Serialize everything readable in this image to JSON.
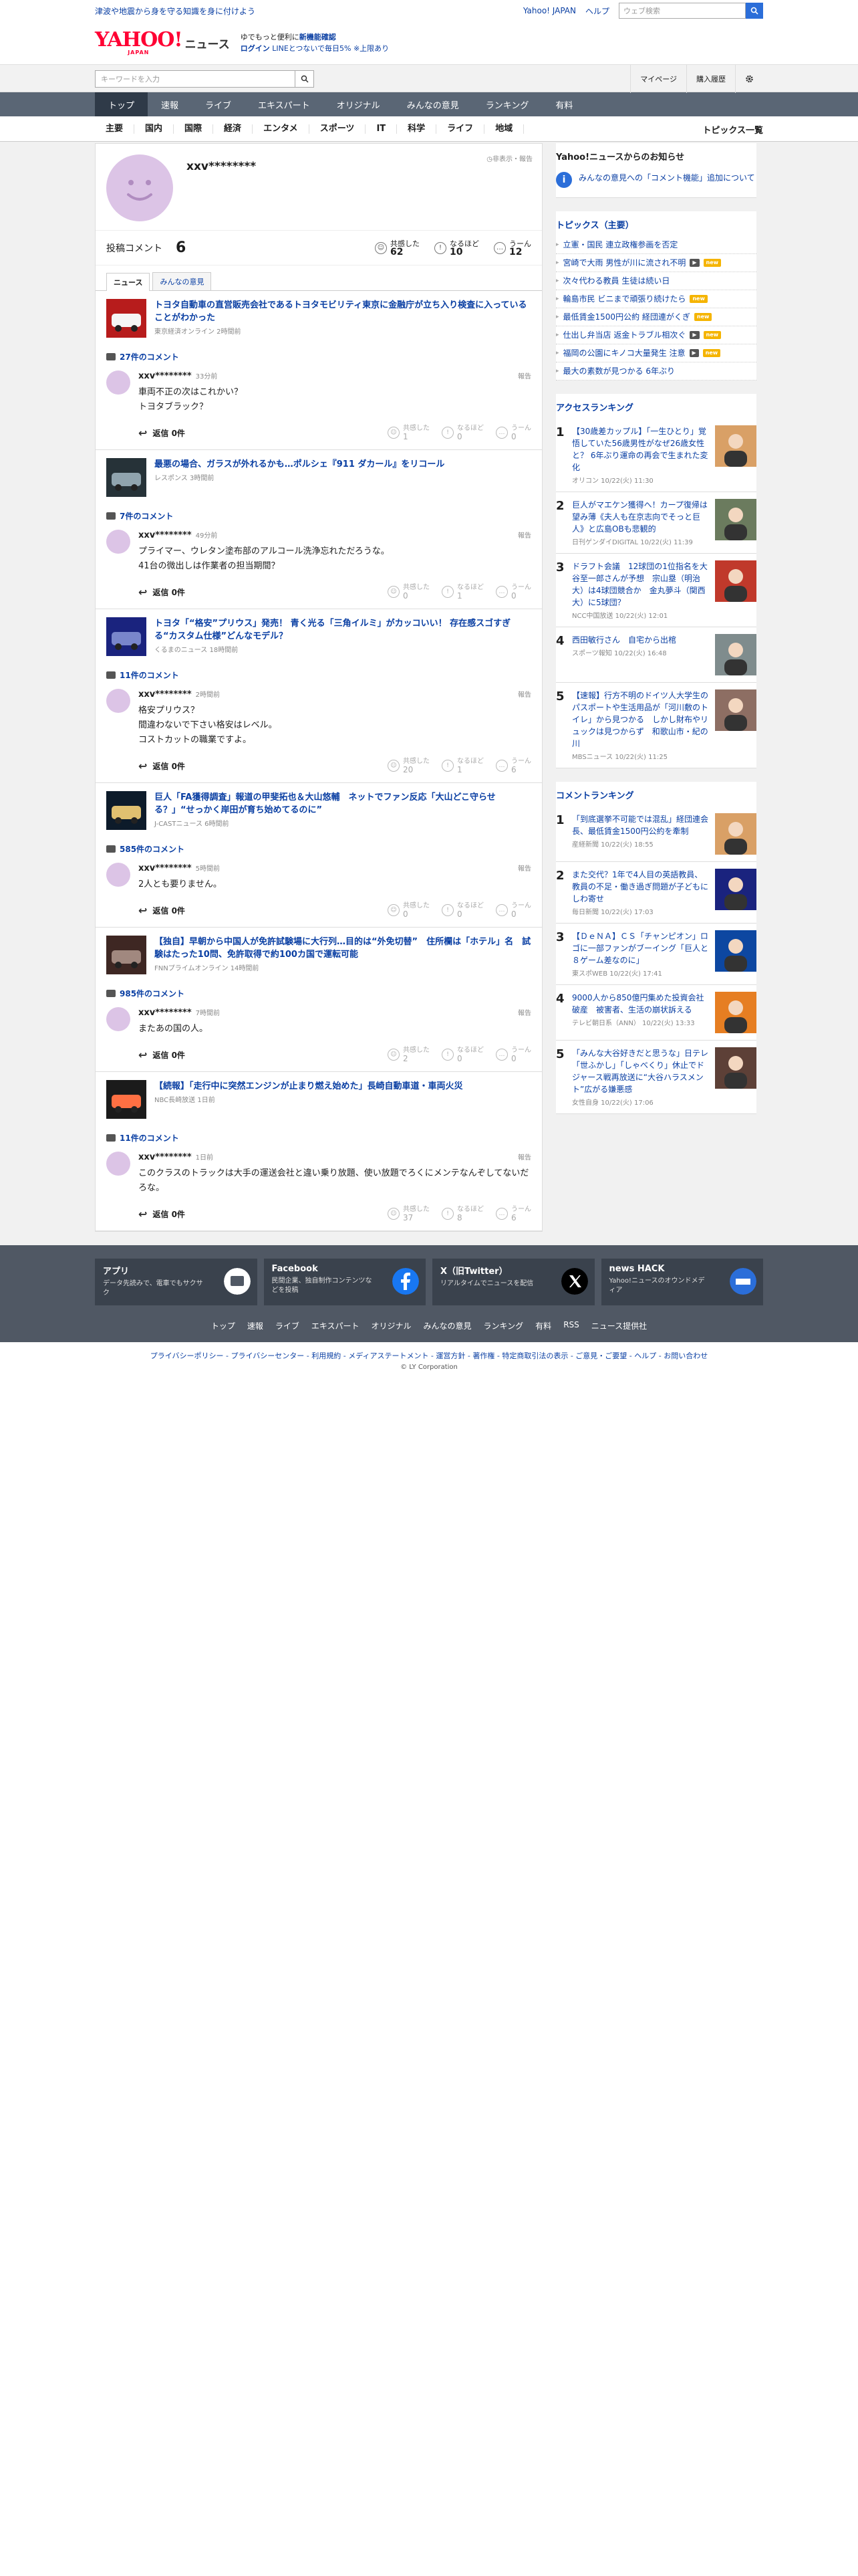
{
  "top": {
    "promo": "津波や地震から身を守る知識を身に付けよう",
    "links": [
      "Yahoo! JAPAN",
      "ヘルプ"
    ],
    "search_placeholder": "ウェブ検索"
  },
  "brand": {
    "logo": "YAHOO!",
    "logo_sub": "JAPAN",
    "section": "ニュース",
    "app_l1_pre": "ゆでもっと便利に",
    "app_l1_bold": "新機能確認",
    "app_l2_login": "ログイン",
    "app_l2_rest": "LINEとつないで毎日5% ※上限あり"
  },
  "searchbar": {
    "placeholder": "キーワードを入力",
    "mypage": "マイページ",
    "history": "購入履歴"
  },
  "nav1": [
    "トップ",
    "速報",
    "ライブ",
    "エキスパート",
    "オリジナル",
    "みんなの意見",
    "ランキング",
    "有料"
  ],
  "nav2": [
    "主要",
    "国内",
    "国際",
    "経済",
    "エンタメ",
    "スポーツ",
    "IT",
    "科学",
    "ライフ",
    "地域"
  ],
  "nav2_list": "トピックス一覧",
  "profile": {
    "name": "xxv********",
    "privacy": "非表示・報告",
    "comments_label": "投稿コメント",
    "comments_count": "6",
    "reactions": [
      {
        "icon": "☺",
        "label": "共感した",
        "count": "62"
      },
      {
        "icon": "!",
        "label": "なるほど",
        "count": "10"
      },
      {
        "icon": "…",
        "label": "うーん",
        "count": "12"
      }
    ]
  },
  "tabs": [
    "ニュース",
    "みんなの意見"
  ],
  "entries": [
    {
      "title": "トヨタ自動車の直営販売会社であるトヨタモビリティ東京に金融庁が立ち入り検査に入っていることがわかった",
      "source": "東京経済オンライン 2時間前",
      "comment_count": "27件のコメント",
      "user": "xxv********",
      "time": "33分前",
      "report": "報告",
      "text": "車両不正の次はこれかい？\nトヨタブラック？",
      "reply": "返信 0件",
      "reacts": [
        {
          "l": "共感した",
          "c": "1"
        },
        {
          "l": "なるほど",
          "c": "0"
        },
        {
          "l": "うーん",
          "c": "0"
        }
      ]
    },
    {
      "title": "最悪の場合、ガラスが外れるかも…ポルシェ『911 ダカール』をリコール",
      "source": "レスポンス 3時間前",
      "comment_count": "7件のコメント",
      "user": "xxv********",
      "time": "49分前",
      "report": "報告",
      "text": "プライマー、ウレタン塗布部のアルコール洗浄忘れただろうな。\n41台の微出しは作業者の担当期間？",
      "reply": "返信 0件",
      "reacts": [
        {
          "l": "共感した",
          "c": "0"
        },
        {
          "l": "なるほど",
          "c": "1"
        },
        {
          "l": "うーん",
          "c": "0"
        }
      ]
    },
    {
      "title": "トヨタ「“格安”プリウス」発売！ 青く光る「三角イルミ」がカッコいい！ 存在感スゴすぎる“カスタム仕様”どんなモデル？",
      "source": "くるまのニュース 18時間前",
      "comment_count": "11件のコメント",
      "user": "xxv********",
      "time": "2時間前",
      "report": "報告",
      "text": "格安プリウス？\n間違わないで下さい格安はレベル。\nコストカットの職業ですよ。",
      "reply": "返信 0件",
      "reacts": [
        {
          "l": "共感した",
          "c": "20"
        },
        {
          "l": "なるほど",
          "c": "1"
        },
        {
          "l": "うーん",
          "c": "6"
        }
      ]
    },
    {
      "title": "巨人「FA獲得調査」報道の甲斐拓也＆大山悠輔　ネットでファン反応「大山どこ守らせる？」“せっかく岸田が育ち始めてるのに”",
      "source": "J-CASTニュース 6時間前",
      "comment_count": "585件のコメント",
      "user": "xxv********",
      "time": "5時間前",
      "report": "報告",
      "text": "2人とも要りません。",
      "reply": "返信 0件",
      "reacts": [
        {
          "l": "共感した",
          "c": "0"
        },
        {
          "l": "なるほど",
          "c": "0"
        },
        {
          "l": "うーん",
          "c": "0"
        }
      ]
    },
    {
      "title": "【独自】早朝から中国人が免許試験場に大行列…目的は“外免切替”　住所欄は「ホテル」名　試験はたった10問、免許取得で約100カ国で運転可能",
      "source": "FNNプライムオンライン 14時間前",
      "comment_count": "985件のコメント",
      "user": "xxv********",
      "time": "7時間前",
      "report": "報告",
      "text": "またあの国の人。",
      "reply": "返信 0件",
      "reacts": [
        {
          "l": "共感した",
          "c": "2"
        },
        {
          "l": "なるほど",
          "c": "0"
        },
        {
          "l": "うーん",
          "c": "0"
        }
      ]
    },
    {
      "title": "【続報】「走行中に突然エンジンが止まり燃え始めた」長崎自動車道・車両火災",
      "source": "NBC長崎放送 1日前",
      "comment_count": "11件のコメント",
      "user": "xxv********",
      "time": "1日前",
      "report": "報告",
      "text": "このクラスのトラックは大手の運送会社と違い乗り放題、使い放題でろくにメンテなんぞしてないだろな。",
      "reply": "返信 0件",
      "reacts": [
        {
          "l": "共感した",
          "c": "37"
        },
        {
          "l": "なるほど",
          "c": "8"
        },
        {
          "l": "うーん",
          "c": "6"
        }
      ]
    }
  ],
  "side": {
    "notice_title": "Yahoo!ニュースからのお知らせ",
    "notice_text": "みんなの意見への「コメント機能」追加について",
    "topics_title": "トピックス（主要）",
    "topics": [
      {
        "t": "立憲・国民 連立政権参画を否定",
        "b": ""
      },
      {
        "t": "宮崎で大雨 男性が川に流され不明",
        "b": "both"
      },
      {
        "t": "次々代わる教員 生徒は続い日",
        "b": ""
      },
      {
        "t": "輪島市民 ビニまで頑張り続けたら",
        "b": "new"
      },
      {
        "t": "最低賃金1500円公約 経団連がくぎ",
        "b": "new"
      },
      {
        "t": "仕出し弁当店 返金トラブル相次ぐ",
        "b": "both"
      },
      {
        "t": "福岡の公園にキノコ大量発生 注意",
        "b": "both"
      },
      {
        "t": "最大の素数が見つかる 6年ぶり",
        "b": ""
      }
    ],
    "access_title": "アクセスランキング",
    "access": [
      {
        "t": "【30歳差カップル】「一生ひとり」覚悟していた56歳男性がなぜ26歳女性と？ 6年ぶり運命の再会で生まれた変化",
        "m": "オリコン 10/22(火) 11:30"
      },
      {
        "t": "巨人がマエケン獲得へ！カープ復帰は望み薄《夫人も在京志向でそっと巨人》と広島OBも悲観的",
        "m": "日刊ゲンダイDIGITAL 10/22(火) 11:39"
      },
      {
        "t": "ドラフト会議　12球団の1位指名を大谷至一郎さんが予想　宗山塁（明治大）は4球団競合か　金丸夢斗（関西大）に5球団？",
        "m": "NCC中国放送 10/22(火) 12:01"
      },
      {
        "t": "西田敏行さん　自宅から出棺",
        "m": "スポーツ報知 10/22(火) 16:48"
      },
      {
        "t": "【速報】行方不明のドイツ人大学生のパスポートや生活用品が「河川敷のトイレ」から見つかる　しかし財布やリュックは見つからず　和歌山市・紀の川",
        "m": "MBSニュース 10/22(火) 11:25"
      }
    ],
    "comment_title": "コメントランキング",
    "comment_rank": [
      {
        "t": "「到底選挙不可能では混乱」経団連会長、最低賃金1500円公約を牽制",
        "m": "産経新聞 10/22(火) 18:55"
      },
      {
        "t": "また交代？1年で4人目の英語教員、教員の不足・働き過ぎ問題が子どもにしわ寄せ",
        "m": "毎日新聞 10/22(火) 17:03"
      },
      {
        "t": "【ＤｅＮＡ】ＣＳ「チャンピオン」ロゴに一部ファンがブーイング「巨人と８ゲーム差なのに」",
        "m": "東スポWEB 10/22(火) 17:41"
      },
      {
        "t": "9000人から850億円集めた投資会社破産　被害者、生活の崩状訴える",
        "m": "テレビ朝日系（ANN） 10/22(火) 13:33"
      },
      {
        "t": "「みんな大谷好きだと思うな」日テレ「世ふかし」「しゃべくり」休止でドジャース戦再放送に“大谷ハラスメント”広がる嫌悪感",
        "m": "女性自身 10/22(火) 17:06"
      }
    ]
  },
  "footer": {
    "cards": [
      {
        "h": "アプリ",
        "d": "データ先読みで、電車でもサクサク"
      },
      {
        "h": "Facebook",
        "d": "民間企業、独自制作コンテンツなどを投稿"
      },
      {
        "h": "X（旧Twitter）",
        "d": "リアルタイムでニュースを配信"
      },
      {
        "h": "news HACK",
        "d": "Yahoo!ニュースのオウンドメディア"
      }
    ],
    "nav": [
      "トップ",
      "速報",
      "ライブ",
      "エキスパート",
      "オリジナル",
      "みんなの意見",
      "ランキング",
      "有料",
      "RSS",
      "ニュース提供社"
    ],
    "legal": "プライバシーポリシー - プライバシーセンター - 利用規約 - メディアステートメント - 運営方針 - 著作権 - 特定商取引法の表示 - ご意見・ご要望 - ヘルプ - お問い合わせ",
    "copy": "© LY Corporation"
  }
}
